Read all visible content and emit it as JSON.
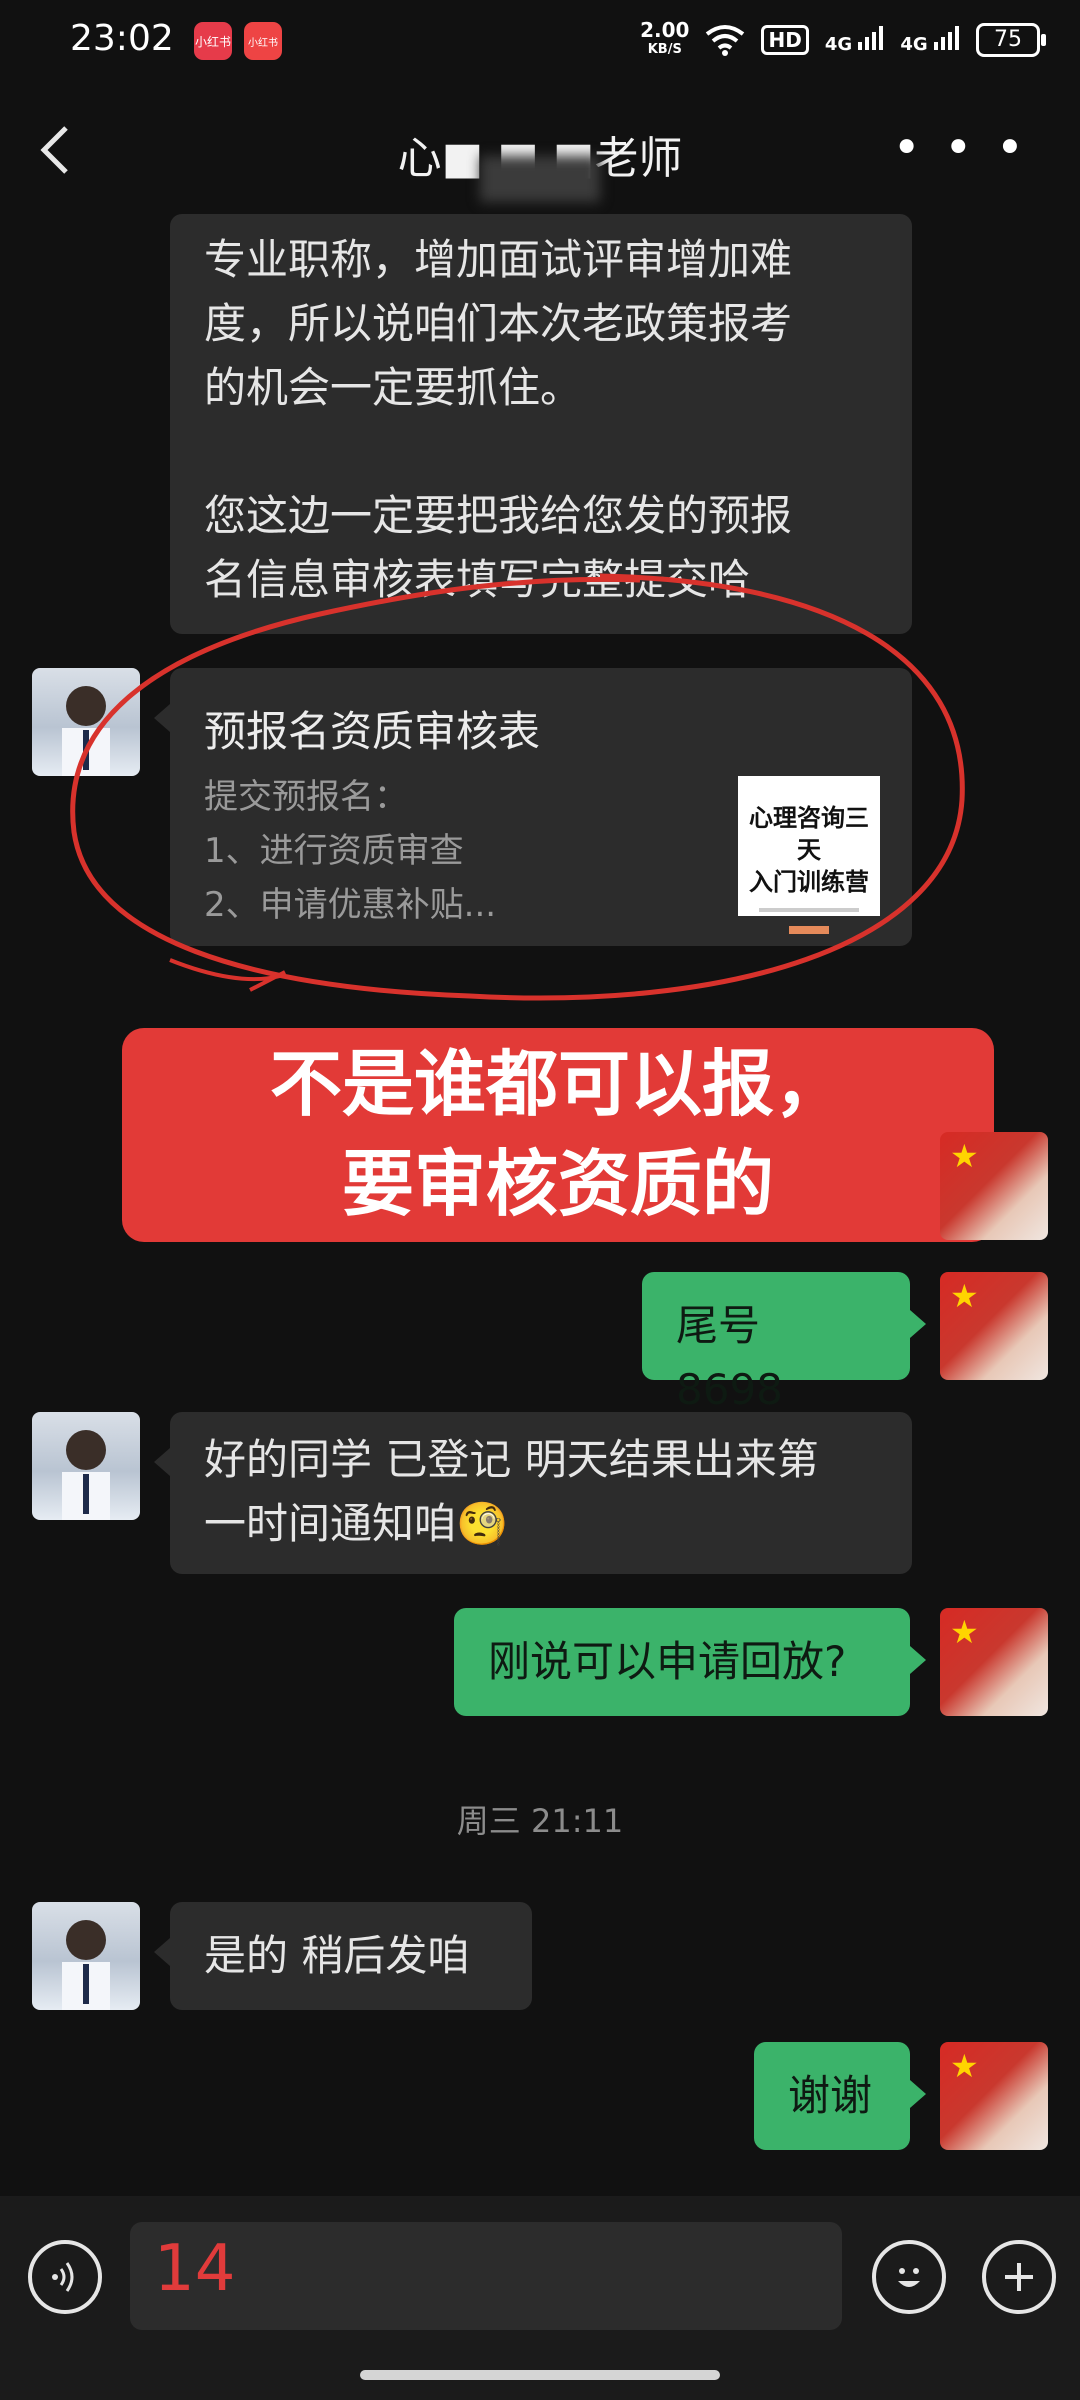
{
  "status_bar": {
    "time": "23:02",
    "apps": [
      "小红书",
      "小红书"
    ],
    "net_speed": "2.00",
    "net_unit": "KB/S",
    "hd_label": "HD",
    "signal1": "4G",
    "signal2": "4G",
    "battery": "75"
  },
  "header": {
    "back_icon": "chevron-left",
    "title": "心■ ■ ■老师",
    "more_icon": "more-dots"
  },
  "messages": {
    "partial_message": {
      "lines": [
        "专业职称，增加面试评审增加难",
        "度，所以说咱们本次老政策报考",
        "的机会一定要抓住。",
        "",
        "您这边一定要把我给您发的预报",
        "名信息审核表填写完整提交哈"
      ]
    },
    "card": {
      "title": "预报名资质审核表",
      "desc_lines": [
        "提交预报名：",
        "1、进行资质审查",
        "2、申请优惠补贴..."
      ],
      "thumb_line1": "心理咨询三天",
      "thumb_line2": "入门训练营"
    },
    "overlay_banner": {
      "line1": "不是谁都可以报，",
      "line2": "要审核资质的"
    },
    "out1": "尾号 8698",
    "in2_line1": "好的同学 已登记 明天结果出来第",
    "in2_line2": "一时间通知咱",
    "emoji": "🧐",
    "out2": "刚说可以申请回放?",
    "timestamp": "周三 21:11",
    "in3": "是的 稍后发咱",
    "out3": "谢谢"
  },
  "bottom_bar": {
    "voice_icon": "voice-icon",
    "input_value": "14",
    "emoji_icon": "emoji-icon",
    "add_icon": "plus-icon"
  },
  "colors": {
    "background": "#111111",
    "incoming_bubble": "#2c2c2c",
    "outgoing_bubble": "#3bb36a",
    "banner": "#e23a37",
    "annotation_circle": "#d8322c"
  }
}
